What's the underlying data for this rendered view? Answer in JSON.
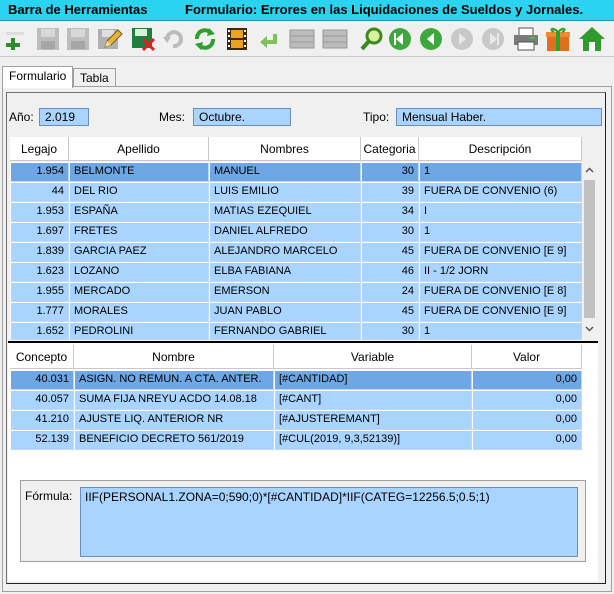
{
  "titlebar": {
    "left": "Barra de Herramientas",
    "right": "Formulario: Errores en las Liquidaciones de Sueldos y Jornales."
  },
  "toolbar": {
    "buttons": [
      {
        "icon": "add-icon",
        "enabled": true
      },
      {
        "icon": "save-icon",
        "enabled": false
      },
      {
        "icon": "save-all-icon",
        "enabled": false
      },
      {
        "icon": "save-disk-icon",
        "enabled": false
      },
      {
        "icon": "edit-icon",
        "enabled": true
      },
      {
        "icon": "delete-icon",
        "enabled": true
      },
      {
        "icon": "undo-icon",
        "enabled": false
      },
      {
        "icon": "refresh-icon",
        "enabled": true
      },
      {
        "icon": "film-icon",
        "enabled": true
      },
      {
        "icon": "back-arrow-icon",
        "enabled": true
      },
      {
        "icon": "grid-icon",
        "enabled": false
      },
      {
        "icon": "grid-alt-icon",
        "enabled": false
      },
      {
        "icon": "search-icon",
        "enabled": true
      },
      {
        "icon": "first-record-icon",
        "enabled": true
      },
      {
        "icon": "previous-record-icon",
        "enabled": true
      },
      {
        "icon": "next-record-icon",
        "enabled": false
      },
      {
        "icon": "last-record-icon",
        "enabled": false
      },
      {
        "icon": "print-icon",
        "enabled": true
      },
      {
        "icon": "gift-icon",
        "enabled": true
      },
      {
        "icon": "home-icon",
        "enabled": true
      }
    ]
  },
  "tabs": [
    {
      "label": "Formulario",
      "active": true
    },
    {
      "label": "Tabla",
      "active": false
    }
  ],
  "header": {
    "anio_label": "Año:",
    "anio_value": "2.019",
    "mes_label": "Mes:",
    "mes_value": "Octubre.",
    "tipo_label": "Tipo:",
    "tipo_value": "Mensual Haber."
  },
  "employees": {
    "columns": [
      "Legajo",
      "Apellido",
      "Nombres",
      "Categoria",
      "Descripción"
    ],
    "rows": [
      {
        "legajo": "1.954",
        "apellido": "BELMONTE",
        "nombres": "MANUEL",
        "categoria": "30",
        "descripcion": "1",
        "selected": true
      },
      {
        "legajo": "44",
        "apellido": "DEL RIO",
        "nombres": "LUIS EMILIO",
        "categoria": "39",
        "descripcion": "FUERA DE CONVENIO (6)",
        "selected": false
      },
      {
        "legajo": "1.953",
        "apellido": "ESPAÑA",
        "nombres": "MATIAS EZEQUIEL",
        "categoria": "34",
        "descripcion": "I",
        "selected": false
      },
      {
        "legajo": "1.697",
        "apellido": "FRETES",
        "nombres": "DANIEL ALFREDO",
        "categoria": "30",
        "descripcion": "1",
        "selected": false
      },
      {
        "legajo": "1.839",
        "apellido": "GARCIA PAEZ",
        "nombres": "ALEJANDRO MARCELO",
        "categoria": "45",
        "descripcion": "FUERA DE CONVENIO [E 9]",
        "selected": false
      },
      {
        "legajo": "1.623",
        "apellido": "LOZANO",
        "nombres": "ELBA FABIANA",
        "categoria": "46",
        "descripcion": "II - 1/2 JORN",
        "selected": false
      },
      {
        "legajo": "1.955",
        "apellido": "MERCADO",
        "nombres": "EMERSON",
        "categoria": "24",
        "descripcion": "FUERA DE CONVENIO [E 8]",
        "selected": false
      },
      {
        "legajo": "1.777",
        "apellido": "MORALES",
        "nombres": "JUAN PABLO",
        "categoria": "45",
        "descripcion": "FUERA DE CONVENIO [E 9]",
        "selected": false
      },
      {
        "legajo": "1.652",
        "apellido": "PEDROLINI",
        "nombres": "FERNANDO GABRIEL",
        "categoria": "30",
        "descripcion": "1",
        "selected": false
      }
    ]
  },
  "concepts": {
    "columns": [
      "Concepto",
      "Nombre",
      "Variable",
      "Valor"
    ],
    "rows": [
      {
        "concepto": "40.031",
        "nombre": "ASIGN. NO REMUN. A CTA. ANTER.",
        "variable": "[#CANTIDAD]",
        "valor": "0,00",
        "selected": true
      },
      {
        "concepto": "40.057",
        "nombre": "SUMA FIJA NREYU ACDO 14.08.18",
        "variable": "[#CANT]",
        "valor": "0,00",
        "selected": false
      },
      {
        "concepto": "41.210",
        "nombre": "AJUSTE LIQ. ANTERIOR NR",
        "variable": "[#AJUSTEREMANT]",
        "valor": "0,00",
        "selected": false
      },
      {
        "concepto": "52.139",
        "nombre": "BENEFICIO DECRETO 561/2019",
        "variable": "[#CUL(2019, 9,3,52139)]",
        "valor": "0,00",
        "selected": false
      }
    ]
  },
  "formula": {
    "label": "Fórmula:",
    "value": "IIF(PERSONAL1.ZONA=0;590;0)*[#CANTIDAD]*IIF(CATEG=12256.5;0.5;1)"
  }
}
